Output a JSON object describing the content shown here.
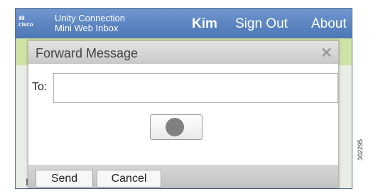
{
  "app": {
    "logo_bars": "ılıılı",
    "logo_word": "cisco",
    "title_line1": "Unity Connection",
    "title_line2": "Mini Web Inbox",
    "user_name": "Kim",
    "sign_out_label": "Sign Out",
    "about_label": "About",
    "background_letter": "I"
  },
  "dialog": {
    "title": "Forward Message",
    "close_glyph": "✕",
    "to_label": "To:",
    "to_value": "",
    "send_label": "Send",
    "cancel_label": "Cancel",
    "record_icon": "record-icon"
  },
  "figure_number": "302295",
  "colors": {
    "header_blue": "#5a83c3",
    "accent_green": "#cfe3a6",
    "dialog_header": "#d4d4d4"
  }
}
